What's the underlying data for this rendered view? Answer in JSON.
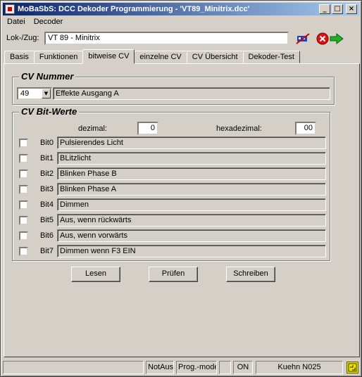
{
  "window": {
    "title": "MoBaSbS: DCC Dekoder Programmierung  -  'VT89_Minitrix.dcc'"
  },
  "menu": [
    "Datei",
    "Decoder"
  ],
  "lok": {
    "label": "Lok-/Zug:",
    "value": "VT 89 - Minitrix"
  },
  "tabs": [
    "Basis",
    "Funktionen",
    "bitweise CV",
    "einzelne CV",
    "CV Übersicht",
    "Dekoder-Test"
  ],
  "cv_group": {
    "title": "CV Nummer",
    "selected": "49",
    "description": "Effekte Ausgang A"
  },
  "bits_group": {
    "title": "CV Bit-Werte",
    "decimal_label": "dezimal:",
    "decimal_value": "0",
    "hex_label": "hexadezimal:",
    "hex_value": "00",
    "bits": [
      {
        "label": "Bit0",
        "text": "Pulsierendes Licht"
      },
      {
        "label": "Bit1",
        "text": "BLitzlicht"
      },
      {
        "label": "Bit2",
        "text": "Blinken Phase B"
      },
      {
        "label": "Bit3",
        "text": "Blinken Phase A"
      },
      {
        "label": "Bit4",
        "text": "Dimmen"
      },
      {
        "label": "Bit5",
        "text": "Aus, wenn rückwärts"
      },
      {
        "label": "Bit6",
        "text": "Aus, wenn vorwärts"
      },
      {
        "label": "Bit7",
        "text": "Dimmen wenn F3 EIN"
      }
    ]
  },
  "buttons": {
    "read": "Lesen",
    "verify": "Prüfen",
    "write": "Schreiben"
  },
  "status": {
    "notaus": "NotAus",
    "mode": "Prog.-mode",
    "empty": "",
    "on": "ON",
    "system": "Kuehn N025"
  },
  "icons": [
    "loco-decoder-icon",
    "stop-circle-icon",
    "green-arrow-icon",
    "connection-status-icon"
  ],
  "colors": {
    "title_start": "#0a246a",
    "title_end": "#a6caf0",
    "face": "#d4d0c8"
  }
}
